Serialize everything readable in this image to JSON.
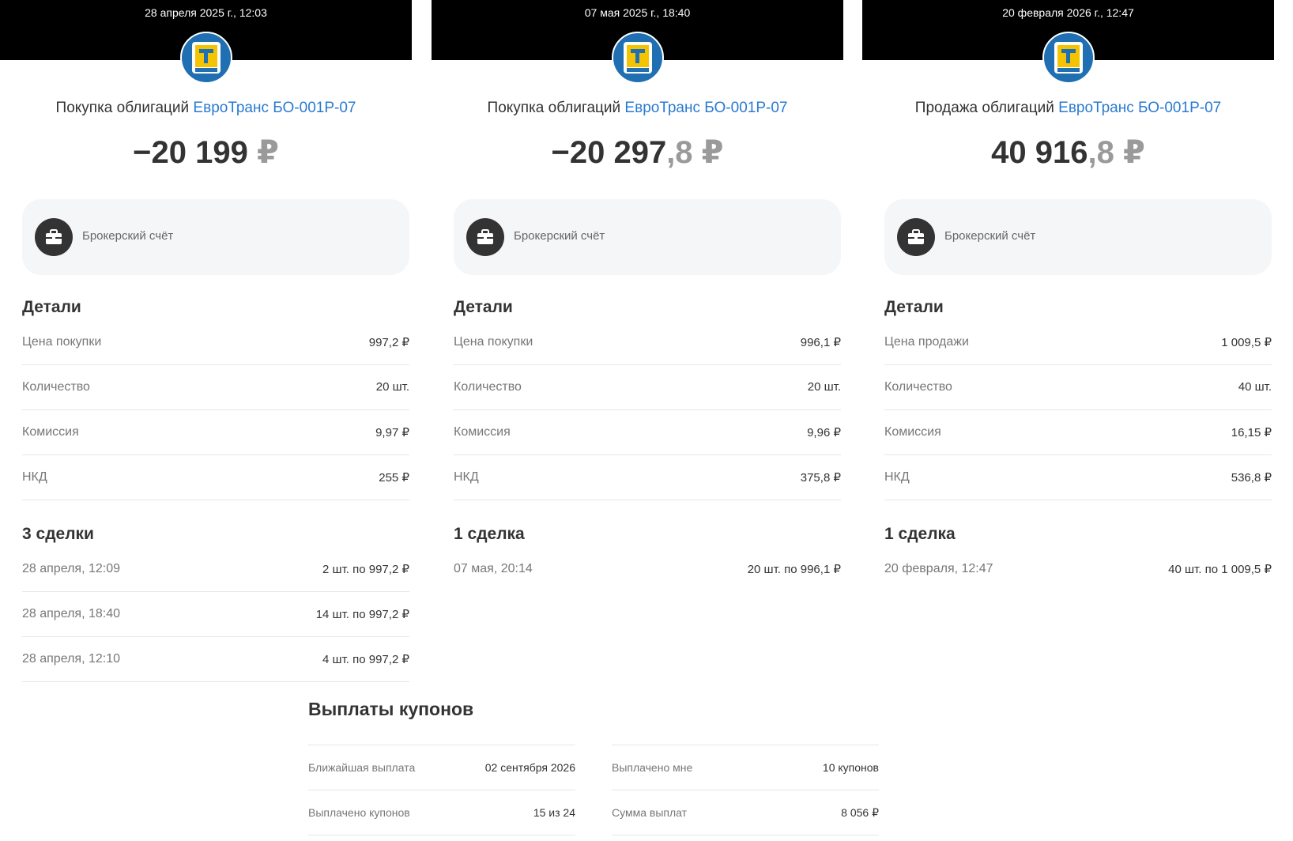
{
  "colors": {
    "header_bg": "#000000",
    "link": "#2a7ad2",
    "logo_bg": "#1f6fb2",
    "logo_accent": "#f5c400",
    "card_bg": "#f5f6f8"
  },
  "icons": {
    "logo": "trassa-logo-icon",
    "account": "briefcase-icon"
  },
  "panels": [
    {
      "date": "28 апреля 2025 г., 12:03",
      "title_prefix": "Покупка облигаций",
      "title_link": "ЕвроТранс БО-001Р-07",
      "amount_int": "−20 199",
      "amount_frac": "",
      "currency": "₽",
      "account": "Брокерский счёт",
      "details_title": "Детали",
      "details": [
        {
          "label": "Цена покупки",
          "value": "997,2 ₽"
        },
        {
          "label": "Количество",
          "value": "20 шт."
        },
        {
          "label": "Комиссия",
          "value": "9,97 ₽"
        },
        {
          "label": "НКД",
          "value": "255 ₽"
        }
      ],
      "deals_title": "3 сделки",
      "deals": [
        {
          "label": "28 апреля, 12:09",
          "value": "2 шт. по 997,2 ₽"
        },
        {
          "label": "28 апреля, 18:40",
          "value": "14 шт. по 997,2 ₽"
        },
        {
          "label": "28 апреля, 12:10",
          "value": "4 шт. по 997,2 ₽"
        }
      ]
    },
    {
      "date": "07 мая 2025 г., 18:40",
      "title_prefix": "Покупка облигаций",
      "title_link": "ЕвроТранс БО-001Р-07",
      "amount_int": "−20 297",
      "amount_frac": ",8",
      "currency": "₽",
      "account": "Брокерский счёт",
      "details_title": "Детали",
      "details": [
        {
          "label": "Цена покупки",
          "value": "996,1 ₽"
        },
        {
          "label": "Количество",
          "value": "20 шт."
        },
        {
          "label": "Комиссия",
          "value": "9,96 ₽"
        },
        {
          "label": "НКД",
          "value": "375,8 ₽"
        }
      ],
      "deals_title": "1 сделка",
      "deals": [
        {
          "label": "07 мая, 20:14",
          "value": "20 шт. по 996,1 ₽"
        }
      ]
    },
    {
      "date": "20 февраля 2026 г., 12:47",
      "title_prefix": "Продажа облигаций",
      "title_link": "ЕвроТранс БО-001Р-07",
      "amount_int": "40 916",
      "amount_frac": ",8",
      "currency": "₽",
      "account": "Брокерский счёт",
      "details_title": "Детали",
      "details": [
        {
          "label": "Цена продажи",
          "value": "1 009,5 ₽"
        },
        {
          "label": "Количество",
          "value": "40 шт."
        },
        {
          "label": "Комиссия",
          "value": "16,15 ₽"
        },
        {
          "label": "НКД",
          "value": "536,8 ₽"
        }
      ],
      "deals_title": "1 сделка",
      "deals": [
        {
          "label": "20 февраля, 12:47",
          "value": "40 шт. по 1 009,5 ₽"
        }
      ]
    }
  ],
  "coupons": {
    "title": "Выплаты купонов",
    "items": [
      {
        "label": "Ближайшая выплата",
        "value": "02 сентября 2026"
      },
      {
        "label": "Выплачено мне",
        "value": "10 купонов"
      },
      {
        "label": "Выплачено купонов",
        "value": "15 из 24"
      },
      {
        "label": "Сумма выплат",
        "value": "8 056 ₽"
      }
    ]
  }
}
